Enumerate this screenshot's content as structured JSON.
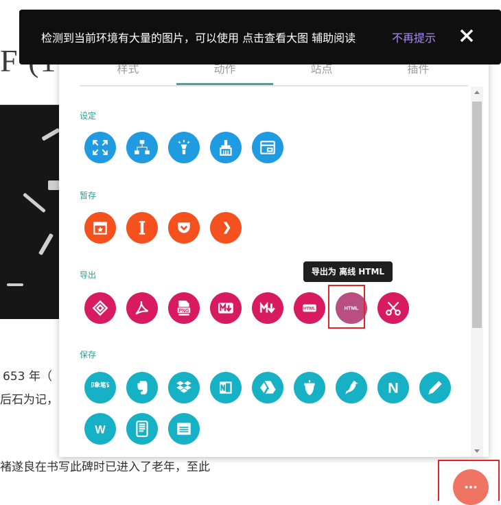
{
  "background": {
    "title_fragment": "F (1",
    "line1": "653 年（",
    "line2": "后石为记，",
    "line3": "褚遂良在书写此碑时已进入了老年，至此"
  },
  "banner": {
    "text": "检测到当前环境有大量的图片，可以使用 点击查看大图 辅助阅读",
    "dismiss_link": "不再提示"
  },
  "tabs": [
    {
      "label": "样式"
    },
    {
      "label": "动作"
    },
    {
      "label": "站点"
    },
    {
      "label": "插件"
    }
  ],
  "sections": {
    "settings": {
      "label": "设定"
    },
    "stash": {
      "label": "暂存"
    },
    "export": {
      "label": "导出"
    },
    "save": {
      "label": "保存"
    }
  },
  "export_icons": {
    "png_label": "PNG",
    "html_label": "HTML",
    "html_offline_label": "HTML"
  },
  "save_icons": {
    "yinxiang_label": "印象笔记",
    "notion_label": "N",
    "wiz_label": "W"
  },
  "tooltip": {
    "text": "导出为 离线 HTML"
  },
  "colors": {
    "settings": "#1f9be2",
    "stash": "#f4511e",
    "export": "#d81b60",
    "save": "#17b1c6",
    "accent": "#2a9d96",
    "highlight": "#e02424",
    "fab": "#ef7463"
  }
}
